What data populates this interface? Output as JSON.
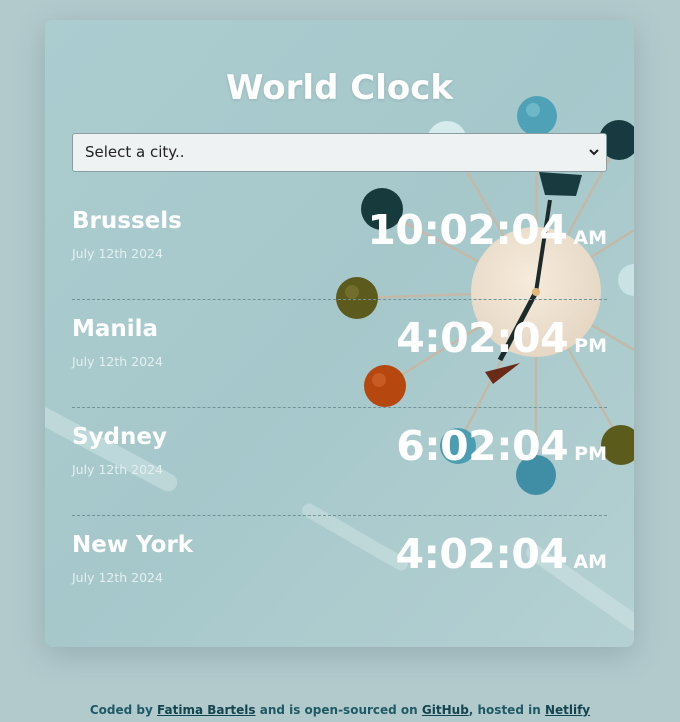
{
  "page": {
    "title": "World Clock",
    "background_color": "#b3cacd",
    "accent_color": "#1e5a66"
  },
  "city_select": {
    "placeholder": "Select a city..",
    "icon": "chevron-down-icon"
  },
  "clocks": [
    {
      "city": "Brussels",
      "date": "July 12th 2024",
      "time": "10:02:04",
      "ampm": "AM"
    },
    {
      "city": "Manila",
      "date": "July 12th 2024",
      "time": "4:02:04",
      "ampm": "PM"
    },
    {
      "city": "Sydney",
      "date": "July 12th 2024",
      "time": "6:02:04",
      "ampm": "PM"
    },
    {
      "city": "New York",
      "date": "July 12th 2024",
      "time": "4:02:04",
      "ampm": "AM"
    }
  ],
  "footer": {
    "prefix": "Coded by",
    "author": "Fatima Bartels",
    "middle": "and is open-sourced on",
    "repo_link": "GitHub",
    "hosted_text": ", hosted in",
    "host_link": "Netlify"
  }
}
